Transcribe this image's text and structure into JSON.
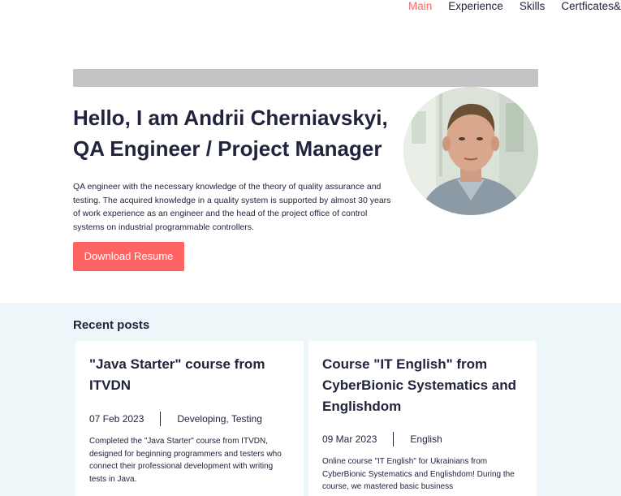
{
  "nav": {
    "items": [
      {
        "label": "Main",
        "active": true
      },
      {
        "label": "Experience",
        "active": false
      },
      {
        "label": "Skills",
        "active": false
      },
      {
        "label": "Certficates&A",
        "active": false
      }
    ]
  },
  "hero": {
    "title_line1": "Hello, I am Andrii Cherniavskyi,",
    "title_line2": "QA Engineer / Project Manager",
    "description": "QA engineer with the necessary knowledge of the theory of quality assurance and testing. The acquired knowledge in a quality system is supported by almost 30 years of work experience as an engineer and the head of the project office of control systems on industrial programmable controllers.",
    "download_label": "Download Resume"
  },
  "recent": {
    "title": "Recent posts",
    "posts": [
      {
        "title": "\"Java Starter\" course from ITVDN",
        "date": "07 Feb 2023",
        "categories": "Developing, Testing",
        "excerpt": "Completed the \"Java Starter\" course from ITVDN, designed for beginning programmers and testers who connect their professional development with writing tests in Java."
      },
      {
        "title": "Course \"IT English\" from CyberBionic Systematics and Englishdom",
        "date": "09 Mar 2023",
        "categories": "English",
        "excerpt": "Online course \"IT English\" for Ukrainians from CyberBionic Systematics and Englishdom! During the course, we mastered basic business"
      }
    ]
  },
  "colors": {
    "accent": "#ff6464",
    "text": "#21243d",
    "section_bg": "#edf7fa",
    "hero_bar": "#c4c4c4"
  }
}
